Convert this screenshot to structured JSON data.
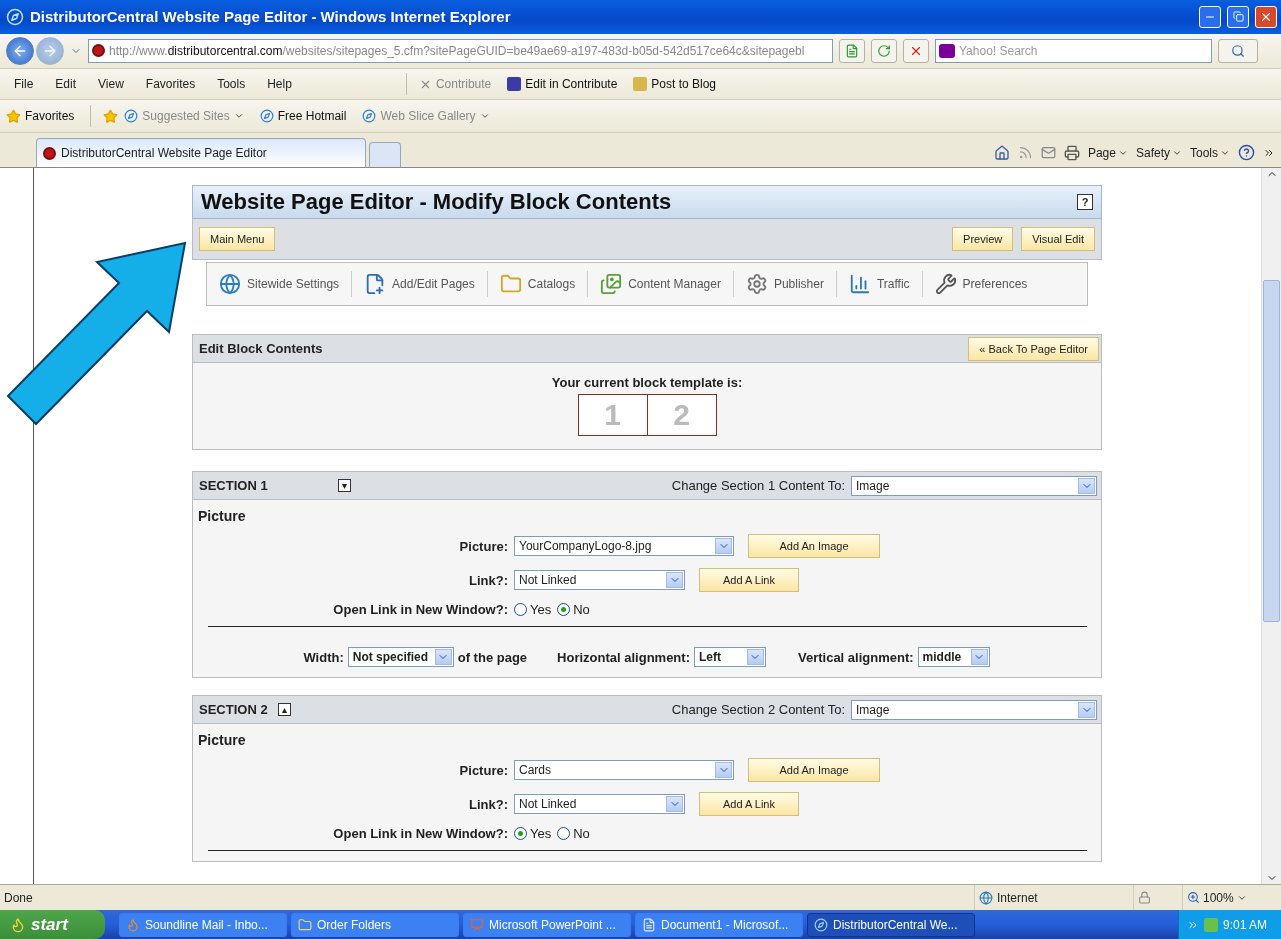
{
  "window": {
    "title": "DistributorCentral Website Page Editor - Windows Internet Explorer"
  },
  "address_bar": {
    "url_prefix": "http://www.",
    "url_domain": "distributorcentral.com",
    "url_path": "/websites/sitepages_5.cfm?sitePageGUID=be49ae69-a197-483d-b05d-542d517ce64c&sitepagebl",
    "search_placeholder": "Yahoo! Search"
  },
  "menu_bar": [
    "File",
    "Edit",
    "View",
    "Favorites",
    "Tools",
    "Help"
  ],
  "addon_bar": [
    {
      "label": "Contribute",
      "kind": "close",
      "disabled": true
    },
    {
      "label": "Edit in Contribute",
      "kind": "contribute",
      "disabled": false
    },
    {
      "label": "Post to Blog",
      "kind": "blog",
      "disabled": false
    }
  ],
  "favorites_bar": {
    "favorites": "Favorites",
    "links": [
      {
        "label": "Suggested Sites",
        "dropdown": true,
        "disabled": true
      },
      {
        "label": "Free Hotmail",
        "dropdown": false,
        "disabled": false
      },
      {
        "label": "Web Slice Gallery",
        "dropdown": true,
        "disabled": true
      }
    ]
  },
  "tabs": [
    {
      "label": "DistributorCentral Website Page Editor",
      "selected": true
    }
  ],
  "command_bar": [
    "Page",
    "Safety",
    "Tools"
  ],
  "editor": {
    "title": "Website Page Editor - Modify Block Contents",
    "help": "?",
    "main_menu": "Main Menu",
    "actions": [
      "Preview",
      "Visual Edit"
    ],
    "nav": [
      {
        "label": "Sitewide Settings",
        "kind": "globe"
      },
      {
        "label": "Add/Edit Pages",
        "kind": "pages"
      },
      {
        "label": "Catalogs",
        "kind": "folder"
      },
      {
        "label": "Content Manager",
        "kind": "content"
      },
      {
        "label": "Publisher",
        "kind": "publisher"
      },
      {
        "label": "Traffic",
        "kind": "traffic"
      },
      {
        "label": "Preferences",
        "kind": "tools"
      }
    ],
    "edit_block": {
      "title": "Edit Block Contents",
      "back": "« Back To Page Editor",
      "template_label": "Your current block template is:",
      "template_cells": [
        "1",
        "2"
      ]
    },
    "sections": [
      {
        "title": "SECTION 1",
        "toggle": "▾",
        "change_label": "Change Section 1 Content To:",
        "content_type": "Image",
        "subtitle": "Picture",
        "fields": [
          {
            "kind": "picture",
            "label": "Picture:",
            "value": "YourCompanyLogo-8.jpg",
            "button": "Add An Image"
          },
          {
            "kind": "link",
            "label": "Link?:",
            "value": "Not Linked",
            "button": "Add A Link"
          }
        ],
        "new_window": {
          "label": "Open Link in New Window?:",
          "options": [
            {
              "label": "Yes",
              "selected": false
            },
            {
              "label": "No",
              "selected": true
            }
          ]
        },
        "layout": {
          "width_label": "Width:",
          "width_value": "Not specified",
          "width_suffix": "of the page",
          "halign_label": "Horizontal alignment:",
          "halign_value": "Left",
          "valign_label": "Vertical alignment:",
          "valign_value": "middle"
        }
      },
      {
        "title": "SECTION 2",
        "toggle": "▴",
        "change_label": "Change Section 2 Content To:",
        "content_type": "Image",
        "subtitle": "Picture",
        "fields": [
          {
            "kind": "picture",
            "label": "Picture:",
            "value": "Cards",
            "button": "Add An Image"
          },
          {
            "kind": "link",
            "label": "Link?:",
            "value": "Not Linked",
            "button": "Add A Link"
          }
        ],
        "new_window": {
          "label": "Open Link in New Window?:",
          "options": [
            {
              "label": "Yes",
              "selected": true
            },
            {
              "label": "No",
              "selected": false
            }
          ]
        }
      }
    ]
  },
  "status_bar": {
    "status": "Done",
    "zone": "Internet",
    "zoom": "100%"
  },
  "taskbar": {
    "start": "start",
    "items": [
      {
        "label": "Soundline Mail - Inbo...",
        "kind": "firefox",
        "selected": false
      },
      {
        "label": "Order Folders",
        "kind": "folder",
        "selected": false
      },
      {
        "label": "Microsoft PowerPoint ...",
        "kind": "powerpoint",
        "selected": false
      },
      {
        "label": "Document1 - Microsof...",
        "kind": "word",
        "selected": false
      },
      {
        "label": "DistributorCentral We...",
        "kind": "ie",
        "selected": true
      }
    ],
    "clock": "9:01 AM"
  }
}
